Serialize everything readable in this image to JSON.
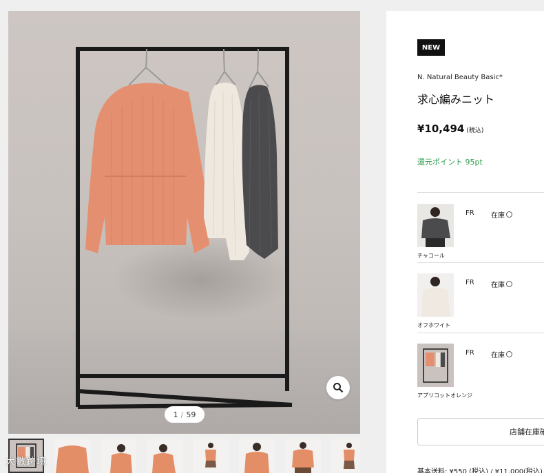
{
  "gallery": {
    "counter_current": "1",
    "counter_separator": "/",
    "counter_total": "59",
    "zoom_icon": "zoom-icon",
    "thumbnail_count": 8,
    "active_thumbnail": 1
  },
  "watermark": "大數跨境",
  "product": {
    "badge": "NEW",
    "brand": "N. Natural Beauty Basic*",
    "name": "求心編みニット",
    "price": "¥10,494",
    "tax_note": "(税込)",
    "points": "還元ポイント 95pt"
  },
  "variants": [
    {
      "color": "チャコール",
      "size": "FR",
      "stock": "在庫"
    },
    {
      "color": "オフホワイト",
      "size": "FR",
      "stock": "在庫"
    },
    {
      "color": "アプリコットオレンジ",
      "size": "FR",
      "stock": "在庫"
    }
  ],
  "store_stock_button": "店舗在庫確",
  "shipping_text": "基本送料: ¥550 (税込) / ¥11,000(税込)",
  "colors": {
    "accent_green": "#2e9d4f",
    "badge_bg": "#111111",
    "sweater_orange": "#e4906a",
    "sweater_white": "#efe9e1",
    "sweater_charcoal": "#4a4a4c"
  }
}
